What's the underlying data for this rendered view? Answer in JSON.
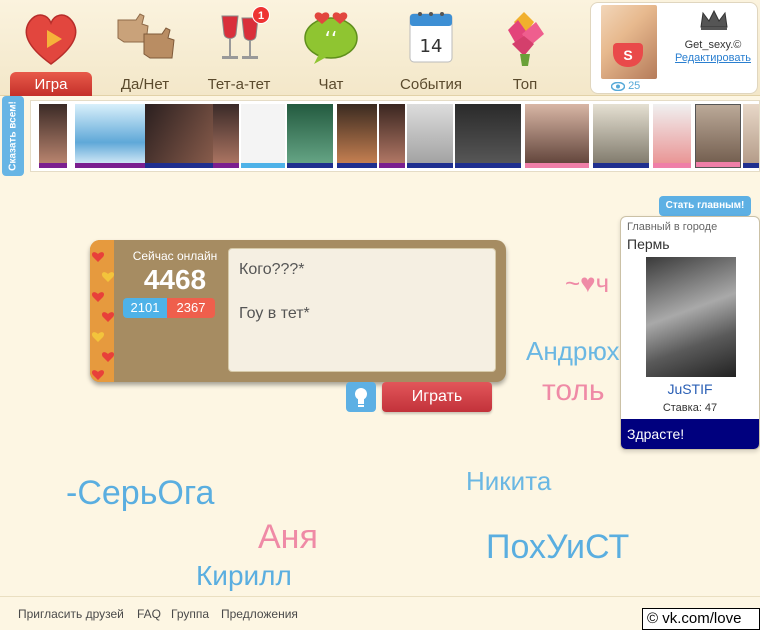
{
  "nav": {
    "items": [
      {
        "label": "Игра",
        "icon": "heart-play-icon"
      },
      {
        "label": "Да/Нет",
        "icon": "thumbs-icon"
      },
      {
        "label": "Тет-а-тет",
        "icon": "wine-glasses-icon",
        "badge": "1"
      },
      {
        "label": "Чат",
        "icon": "chat-heart-icon"
      },
      {
        "label": "События",
        "icon": "calendar-icon",
        "calendar_day": "14"
      },
      {
        "label": "Топ",
        "icon": "bouquet-icon"
      }
    ]
  },
  "profile": {
    "username": "Get_sexy.©",
    "edit_label": "Редактировать",
    "views": "25"
  },
  "strip": {
    "say_all_label": "Сказать всем!"
  },
  "make_main_label": "Стать главным!",
  "city_card": {
    "title": "Главный в городе",
    "city": "Пермь",
    "name": "JuSTIF",
    "bet": "Ставка: 47",
    "message": "Здрасте!"
  },
  "panel": {
    "online_label": "Сейчас онлайн",
    "online_count": "4468",
    "count_a": "2101",
    "count_b": "2367",
    "lines": [
      "Кого???*",
      "Гоу в тет*"
    ]
  },
  "play_label": "Играть",
  "names": {
    "n1": "~♥ч",
    "n2": "Андрюх",
    "n3": "толь",
    "n4": "-СерьОга",
    "n5": "Никита",
    "n6": "Аня",
    "n7": "ПохУиСТ",
    "n8": "Кирилл"
  },
  "footer": {
    "links": [
      "Пригласить друзей",
      "FAQ",
      "Группа",
      "Предложения"
    ]
  },
  "watermark": "© vk.com/love",
  "colors": {
    "accent_red": "#d9403f",
    "accent_blue": "#5db0e4",
    "background": "#fdf6e3"
  }
}
